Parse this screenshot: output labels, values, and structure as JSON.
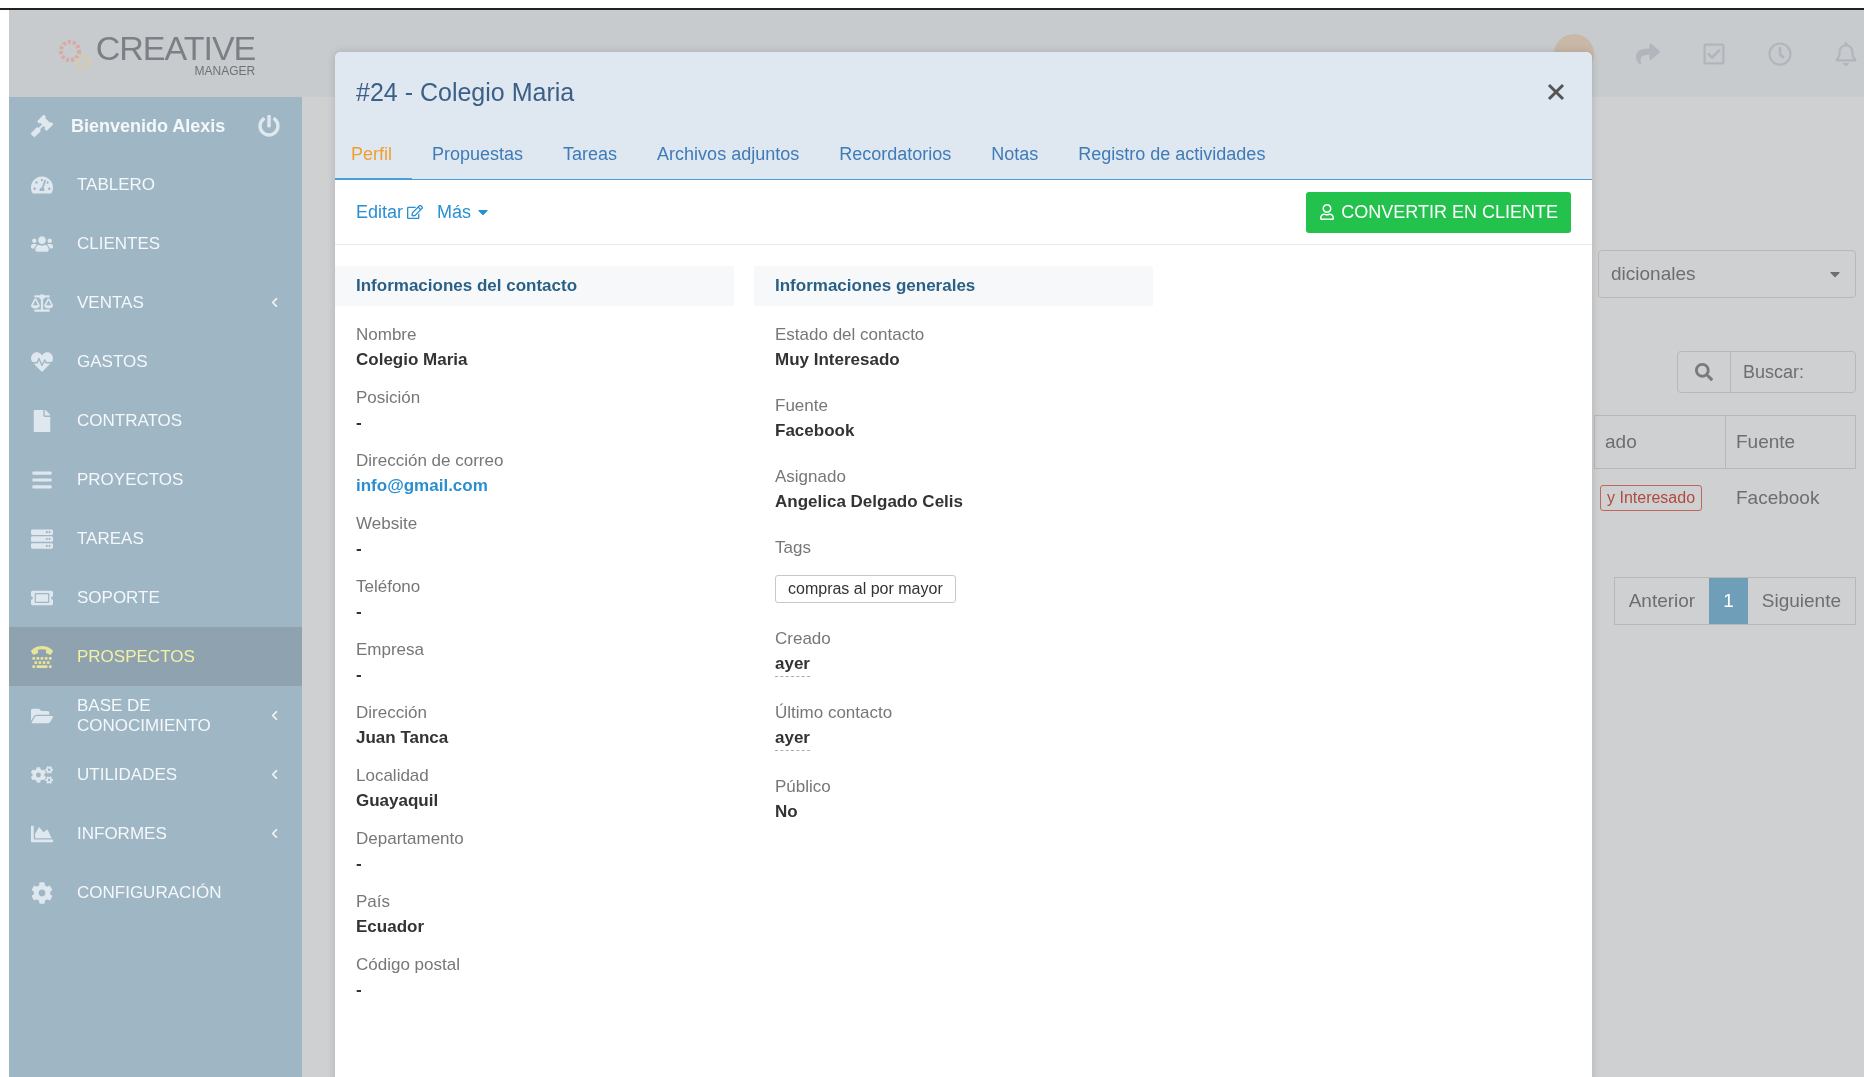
{
  "header": {
    "logo": {
      "main": "CREATIVE",
      "sub": "MANAGER"
    }
  },
  "sidebar": {
    "welcome": "Bienvenido Alexis",
    "items": [
      {
        "label": "TABLERO",
        "selected": false,
        "has_submenu": false
      },
      {
        "label": "CLIENTES",
        "selected": false,
        "has_submenu": false
      },
      {
        "label": "VENTAS",
        "selected": false,
        "has_submenu": true
      },
      {
        "label": "GASTOS",
        "selected": false,
        "has_submenu": false
      },
      {
        "label": "CONTRATOS",
        "selected": false,
        "has_submenu": false
      },
      {
        "label": "PROYECTOS",
        "selected": false,
        "has_submenu": false
      },
      {
        "label": "TAREAS",
        "selected": false,
        "has_submenu": false
      },
      {
        "label": "SOPORTE",
        "selected": false,
        "has_submenu": false
      },
      {
        "label": "PROSPECTOS",
        "selected": true,
        "has_submenu": false
      },
      {
        "label": "BASE DE CONOCIMIENTO",
        "selected": false,
        "has_submenu": true
      },
      {
        "label": "UTILIDADES",
        "selected": false,
        "has_submenu": true
      },
      {
        "label": "INFORMES",
        "selected": false,
        "has_submenu": true
      },
      {
        "label": "CONFIGURACIÓN",
        "selected": false,
        "has_submenu": false
      }
    ]
  },
  "background": {
    "dropdown": "dicionales",
    "search_placeholder": "Buscar:",
    "columns": [
      "ado",
      "Fuente"
    ],
    "row": {
      "status": "y Interesado",
      "source": "Facebook"
    },
    "pagination": {
      "previous": "Anterior",
      "page": "1",
      "next": "Siguiente"
    }
  },
  "modal": {
    "title": "#24 - Colegio Maria",
    "tabs": [
      {
        "label": "Perfil",
        "selected": true
      },
      {
        "label": "Propuestas",
        "selected": false
      },
      {
        "label": "Tareas",
        "selected": false
      },
      {
        "label": "Archivos adjuntos",
        "selected": false
      },
      {
        "label": "Recordatorios",
        "selected": false
      },
      {
        "label": "Notas",
        "selected": false
      },
      {
        "label": "Registro de actividades",
        "selected": false
      }
    ],
    "edit": "Editar",
    "more": "Más",
    "convert_button": "CONVERTIR EN CLIENTE",
    "contact": {
      "title": "Informaciones del contacto",
      "fields": [
        {
          "label": "Nombre",
          "value": "Colegio Maria",
          "kind": "text"
        },
        {
          "label": "Posición",
          "value": "-",
          "kind": "text"
        },
        {
          "label": "Dirección de correo",
          "value": "info@gmail.com",
          "kind": "link"
        },
        {
          "label": "Website",
          "value": "-",
          "kind": "text"
        },
        {
          "label": "Teléfono",
          "value": "-",
          "kind": "text"
        },
        {
          "label": "Empresa",
          "value": "-",
          "kind": "text"
        },
        {
          "label": "Dirección",
          "value": "Juan Tanca",
          "kind": "text"
        },
        {
          "label": "Localidad",
          "value": "Guayaquil",
          "kind": "text"
        },
        {
          "label": "Departamento",
          "value": "-",
          "kind": "text"
        },
        {
          "label": "País",
          "value": "Ecuador",
          "kind": "text"
        },
        {
          "label": "Código postal",
          "value": "-",
          "kind": "text"
        }
      ]
    },
    "general": {
      "title": "Informaciones generales",
      "fields": [
        {
          "label": "Estado del contacto",
          "value": "Muy Interesado",
          "kind": "text"
        },
        {
          "label": "Fuente",
          "value": "Facebook",
          "kind": "text"
        },
        {
          "label": "Asignado",
          "value": "Angelica Delgado Celis",
          "kind": "text"
        },
        {
          "label": "Tags",
          "value": "compras al por mayor",
          "kind": "tag"
        },
        {
          "label": "Creado",
          "value": "ayer",
          "kind": "date"
        },
        {
          "label": "Último contacto",
          "value": "ayer",
          "kind": "date"
        },
        {
          "label": "Público",
          "value": "No",
          "kind": "text"
        }
      ]
    }
  }
}
